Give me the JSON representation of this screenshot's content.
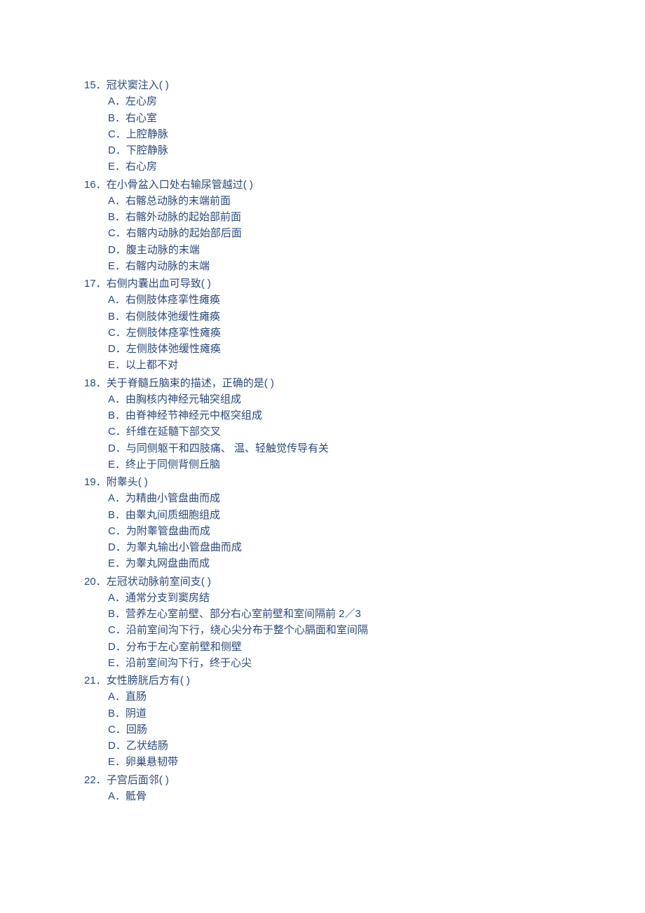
{
  "questions": [
    {
      "num": "15．",
      "stem": "冠状窦注入(   )",
      "options": [
        {
          "letter": "A．",
          "text": "左心房"
        },
        {
          "letter": "B．",
          "text": "右心室"
        },
        {
          "letter": "C．",
          "text": "上腔静脉"
        },
        {
          "letter": "D．",
          "text": "下腔静脉"
        },
        {
          "letter": "E．",
          "text": "右心房"
        }
      ]
    },
    {
      "num": "16．",
      "stem": "在小骨盆入口处右输尿管越过(   )",
      "options": [
        {
          "letter": "A．",
          "text": "右髂总动脉的末端前面"
        },
        {
          "letter": "B．",
          "text": "右髂外动脉的起始部前面"
        },
        {
          "letter": "C．",
          "text": "右髂内动脉的起始部后面"
        },
        {
          "letter": "D．",
          "text": "腹主动脉的末端"
        },
        {
          "letter": "E．",
          "text": "右髂内动脉的末端"
        }
      ]
    },
    {
      "num": "17．",
      "stem": "右侧内囊出血可导致(   )",
      "options": [
        {
          "letter": "A．",
          "text": "右侧肢体痉挛性瘫痪"
        },
        {
          "letter": "B．",
          "text": "右侧肢体弛缓性瘫痪"
        },
        {
          "letter": "C．",
          "text": "左侧肢体痉挛性瘫痪"
        },
        {
          "letter": "D．",
          "text": "左侧肢体弛缓性瘫痪"
        },
        {
          "letter": "E．",
          "text": "以上都不对"
        }
      ]
    },
    {
      "num": "18．",
      "stem": "关于脊髓丘脑束的描述，正确的是(   )",
      "options": [
        {
          "letter": "A．",
          "text": "由胸核内神经元轴突组成"
        },
        {
          "letter": "B．",
          "text": "由脊神经节神经元中枢突组成"
        },
        {
          "letter": "C．",
          "text": "纤维在延髓下部交叉"
        },
        {
          "letter": "D．",
          "text": "与同侧躯干和四肢痛、 温、轻触觉传导有关"
        },
        {
          "letter": "E．",
          "text": "终止于同侧背侧丘脑"
        }
      ]
    },
    {
      "num": "19．",
      "stem": "附睾头(   )",
      "options": [
        {
          "letter": "A．",
          "text": "为精曲小管盘曲而成"
        },
        {
          "letter": "B．",
          "text": "由睾丸间质细胞组成"
        },
        {
          "letter": "C．",
          "text": "为附睾管盘曲而成"
        },
        {
          "letter": "D．",
          "text": "为睾丸输出小管盘曲而成"
        },
        {
          "letter": "E．",
          "text": "为睾丸网盘曲而成"
        }
      ]
    },
    {
      "num": "20．",
      "stem": "左冠状动脉前室间支(   )",
      "options": [
        {
          "letter": "A．",
          "text": "通常分支到窦房结"
        },
        {
          "letter": "B．",
          "text": "营养左心室前壁、部分右心室前壁和室间隔前 2／3"
        },
        {
          "letter": "C．",
          "text": "沿前室间沟下行，绕心尖分布于整个心膈面和室间隔"
        },
        {
          "letter": "D．",
          "text": "分布于左心室前壁和侧壁"
        },
        {
          "letter": "E．",
          "text": "沿前室间沟下行，终于心尖"
        }
      ]
    },
    {
      "num": "21．",
      "stem": "女性膀胱后方有(   )",
      "options": [
        {
          "letter": "A．",
          "text": "直肠"
        },
        {
          "letter": "B．",
          "text": "阴道"
        },
        {
          "letter": "C．",
          "text": "回肠"
        },
        {
          "letter": "D．",
          "text": "乙状结肠"
        },
        {
          "letter": "E．",
          "text": "卵巢悬韧带"
        }
      ]
    },
    {
      "num": "22．",
      "stem": "子宫后面邻(   )",
      "options": [
        {
          "letter": "A．",
          "text": "骶骨"
        }
      ]
    }
  ]
}
